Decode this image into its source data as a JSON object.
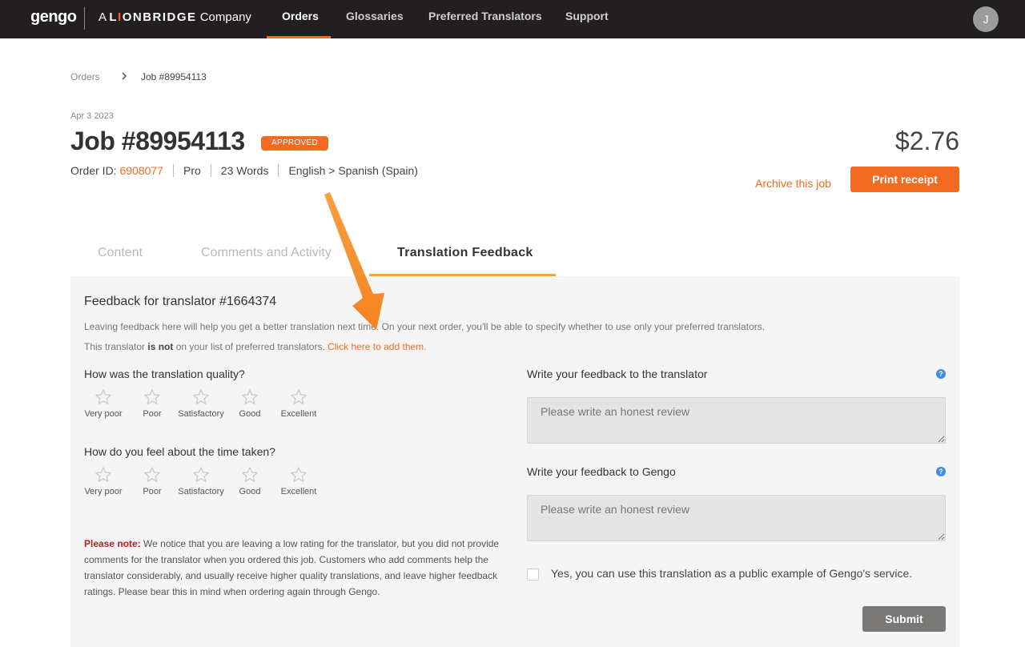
{
  "header": {
    "logo": "gengo",
    "tagline_prefix": "A",
    "tagline_brand_pre": "L",
    "tagline_brand_o": "I",
    "tagline_brand_post": "ONBRIDGE",
    "tagline_suffix": "Company",
    "nav": [
      {
        "label": "Orders",
        "active": true
      },
      {
        "label": "Glossaries",
        "active": false
      },
      {
        "label": "Preferred Translators",
        "active": false
      },
      {
        "label": "Support",
        "active": false
      }
    ],
    "avatar_initial": "J"
  },
  "breadcrumb": {
    "root": "Orders",
    "current": "Job #89954113"
  },
  "job": {
    "date": "Apr 3 2023",
    "title": "Job #89954113",
    "status": "APPROVED",
    "order_id_label": "Order ID:",
    "order_id": "6908077",
    "tier": "Pro",
    "words": "23 Words",
    "language_pair": "English > Spanish (Spain)",
    "price": "$2.76",
    "archive_label": "Archive this job",
    "print_label": "Print receipt"
  },
  "tabs": [
    {
      "label": "Content",
      "active": false
    },
    {
      "label": "Comments and Activity",
      "active": false
    },
    {
      "label": "Translation Feedback",
      "active": true
    }
  ],
  "feedback": {
    "title": "Feedback for translator #1664374",
    "intro": "Leaving feedback here will help you get a better translation next time. On your next order, you'll be able to specify whether to use only your preferred translators.",
    "preferred_pre": "This translator ",
    "preferred_bold": "is not",
    "preferred_post": " on your list of preferred translators. ",
    "preferred_link": "Click here to add them.",
    "quality_question": "How was the translation quality?",
    "time_question": "How do you feel about the time taken?",
    "rating_labels": [
      "Very poor",
      "Poor",
      "Satisfactory",
      "Good",
      "Excellent"
    ],
    "note_label": "Please note:",
    "note_text": " We notice that you are leaving a low rating for the translator, but you did not provide comments for the translator when you ordered this job. Customers who add comments help the translator considerably, and usually receive higher quality translations, and leave higher feedback ratings. Please bear this in mind when ordering again through Gengo.",
    "translator_label": "Write your feedback to the translator",
    "gengo_label": "Write your feedback to Gengo",
    "placeholder": "Please write an honest review",
    "help_glyph": "?",
    "public_example_label": "Yes, you can use this translation as a public example of Gengo's service.",
    "submit_label": "Submit"
  },
  "colors": {
    "accent": "#f26b21",
    "tab_underline": "#f7a13a",
    "topbar": "#231f20",
    "annotation_arrow": "#f7921e"
  }
}
